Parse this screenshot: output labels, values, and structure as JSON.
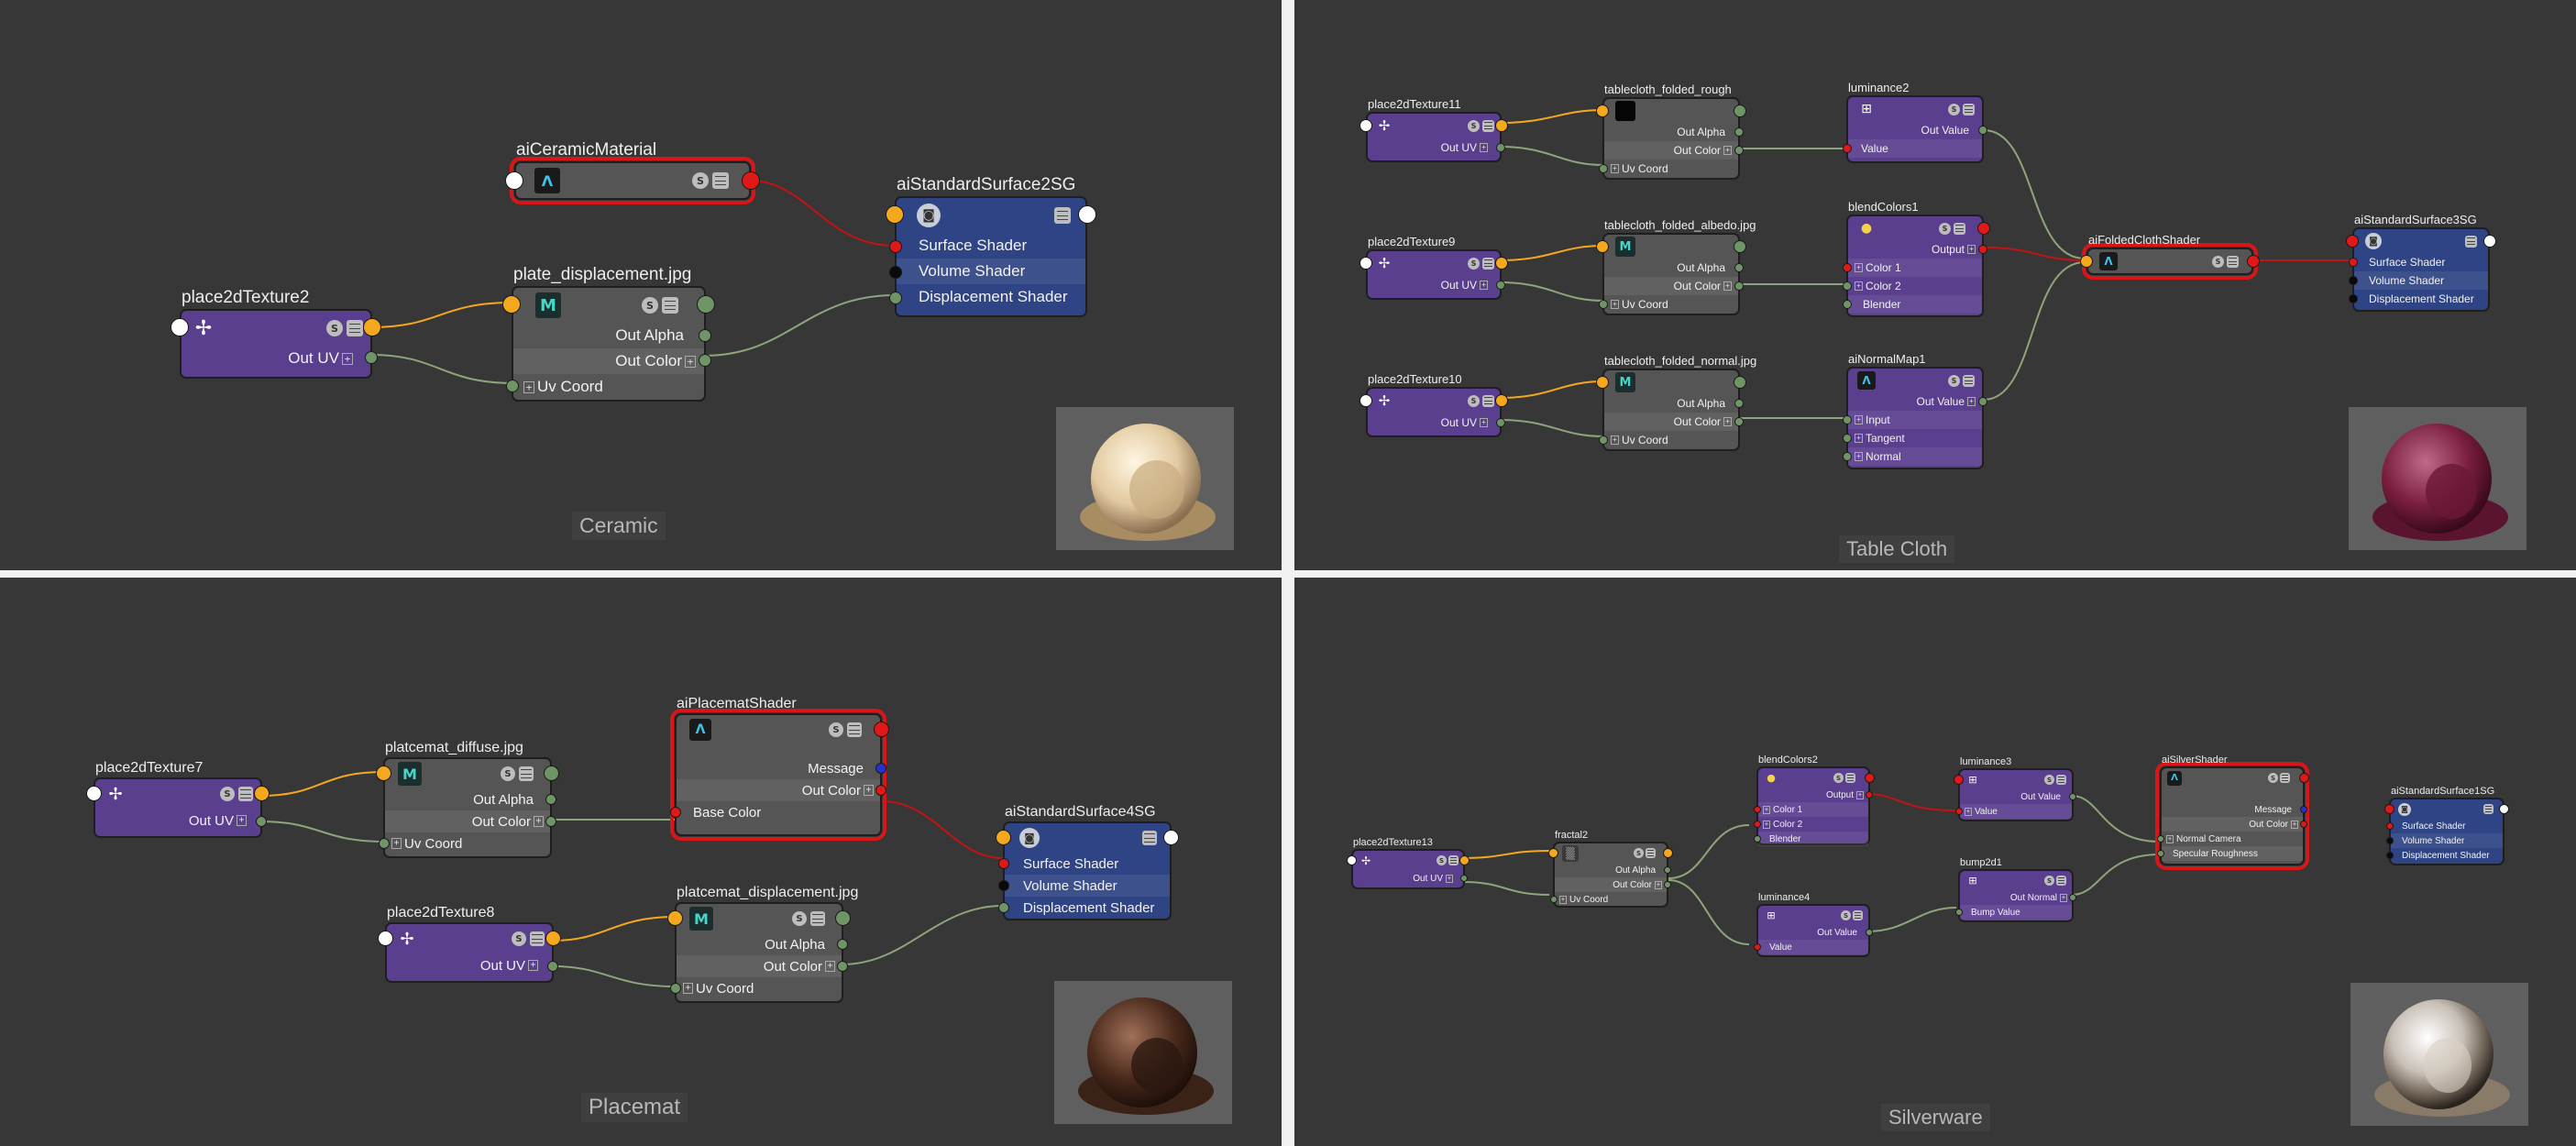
{
  "panels": {
    "ceramic": {
      "label": "Ceramic",
      "nodes": {
        "place2d": {
          "title": "place2dTexture2",
          "out_uv": "Out UV"
        },
        "file": {
          "title": "plate_displacement.jpg",
          "out_alpha": "Out Alpha",
          "out_color": "Out Color",
          "uv_coord": "Uv Coord"
        },
        "material": {
          "title": "aiCeramicMaterial"
        },
        "sg": {
          "title": "aiStandardSurface2SG",
          "surface": "Surface Shader",
          "volume": "Volume Shader",
          "displacement": "Displacement Shader"
        }
      }
    },
    "tablecloth": {
      "label": "Table Cloth",
      "nodes": {
        "p11": {
          "title": "place2dTexture11",
          "out_uv": "Out UV"
        },
        "p9": {
          "title": "place2dTexture9",
          "out_uv": "Out UV"
        },
        "p10": {
          "title": "place2dTexture10",
          "out_uv": "Out UV"
        },
        "rough": {
          "title": "tablecloth_folded_rough",
          "out_alpha": "Out Alpha",
          "out_color": "Out Color",
          "uv_coord": "Uv Coord"
        },
        "albedo": {
          "title": "tablecloth_folded_albedo.jpg",
          "out_alpha": "Out Alpha",
          "out_color": "Out Color",
          "uv_coord": "Uv Coord"
        },
        "normal": {
          "title": "tablecloth_folded_normal.jpg",
          "out_alpha": "Out Alpha",
          "out_color": "Out Color",
          "uv_coord": "Uv Coord"
        },
        "lum": {
          "title": "luminance2",
          "out_value": "Out Value",
          "value": "Value"
        },
        "blend": {
          "title": "blendColors1",
          "output": "Output",
          "color1": "Color 1",
          "color2": "Color 2",
          "blender": "Blender"
        },
        "nmap": {
          "title": "aiNormalMap1",
          "out_value": "Out Value",
          "input": "Input",
          "tangent": "Tangent",
          "normal": "Normal"
        },
        "shader": {
          "title": "aiFoldedClothShader"
        },
        "sg": {
          "title": "aiStandardSurface3SG",
          "surface": "Surface Shader",
          "volume": "Volume Shader",
          "displacement": "Displacement Shader"
        }
      }
    },
    "placemat": {
      "label": "Placemat",
      "nodes": {
        "p7": {
          "title": "place2dTexture7",
          "out_uv": "Out UV"
        },
        "p8": {
          "title": "place2dTexture8",
          "out_uv": "Out UV"
        },
        "diffuse": {
          "title": "platcemat_diffuse.jpg",
          "out_alpha": "Out Alpha",
          "out_color": "Out Color",
          "uv_coord": "Uv Coord"
        },
        "disp": {
          "title": "platcemat_displacement.jpg",
          "out_alpha": "Out Alpha",
          "out_color": "Out Color",
          "uv_coord": "Uv Coord"
        },
        "shader": {
          "title": "aiPlacematShader",
          "message": "Message",
          "out_color": "Out Color",
          "base_color": "Base Color"
        },
        "sg": {
          "title": "aiStandardSurface4SG",
          "surface": "Surface Shader",
          "volume": "Volume Shader",
          "displacement": "Displacement Shader"
        }
      }
    },
    "silverware": {
      "label": "Silverware",
      "nodes": {
        "p13": {
          "title": "place2dTexture13",
          "out_uv": "Out UV"
        },
        "fractal": {
          "title": "fractal2",
          "out_alpha": "Out Alpha",
          "out_color": "Out Color",
          "uv_coord": "Uv Coord"
        },
        "blend": {
          "title": "blendColors2",
          "output": "Output",
          "color1": "Color 1",
          "color2": "Color 2",
          "blender": "Blender"
        },
        "lum4": {
          "title": "luminance4",
          "out_value": "Out Value",
          "value": "Value"
        },
        "lum3": {
          "title": "luminance3",
          "out_value": "Out Value",
          "value": "Value"
        },
        "bump": {
          "title": "bump2d1",
          "out_normal": "Out Normal",
          "bump_value": "Bump Value"
        },
        "shader": {
          "title": "aiSilverShader",
          "message": "Message",
          "out_color": "Out Color",
          "normal_camera": "Normal Camera",
          "spec_rough": "Specular Roughness"
        },
        "sg": {
          "title": "aiStandardSurface1SG",
          "surface": "Surface Shader",
          "volume": "Volume Shader",
          "displacement": "Displacement Shader"
        }
      }
    }
  },
  "glyphs": {
    "s": "S",
    "m": "M",
    "a": "Λ",
    "place": "✢",
    "plus": "+",
    "sg": "◙",
    "lum": "⊞",
    "blend": "●",
    "frac": "▒"
  },
  "colors": {
    "panel_bg": "#373737",
    "purple_node": "#5b3f8f",
    "gray_node": "#555555",
    "blue_node": "#2f4484",
    "selection": "#d8161a",
    "wire_green": "#8ea47c",
    "wire_orange": "#f4a81e",
    "wire_red": "#c01414"
  }
}
